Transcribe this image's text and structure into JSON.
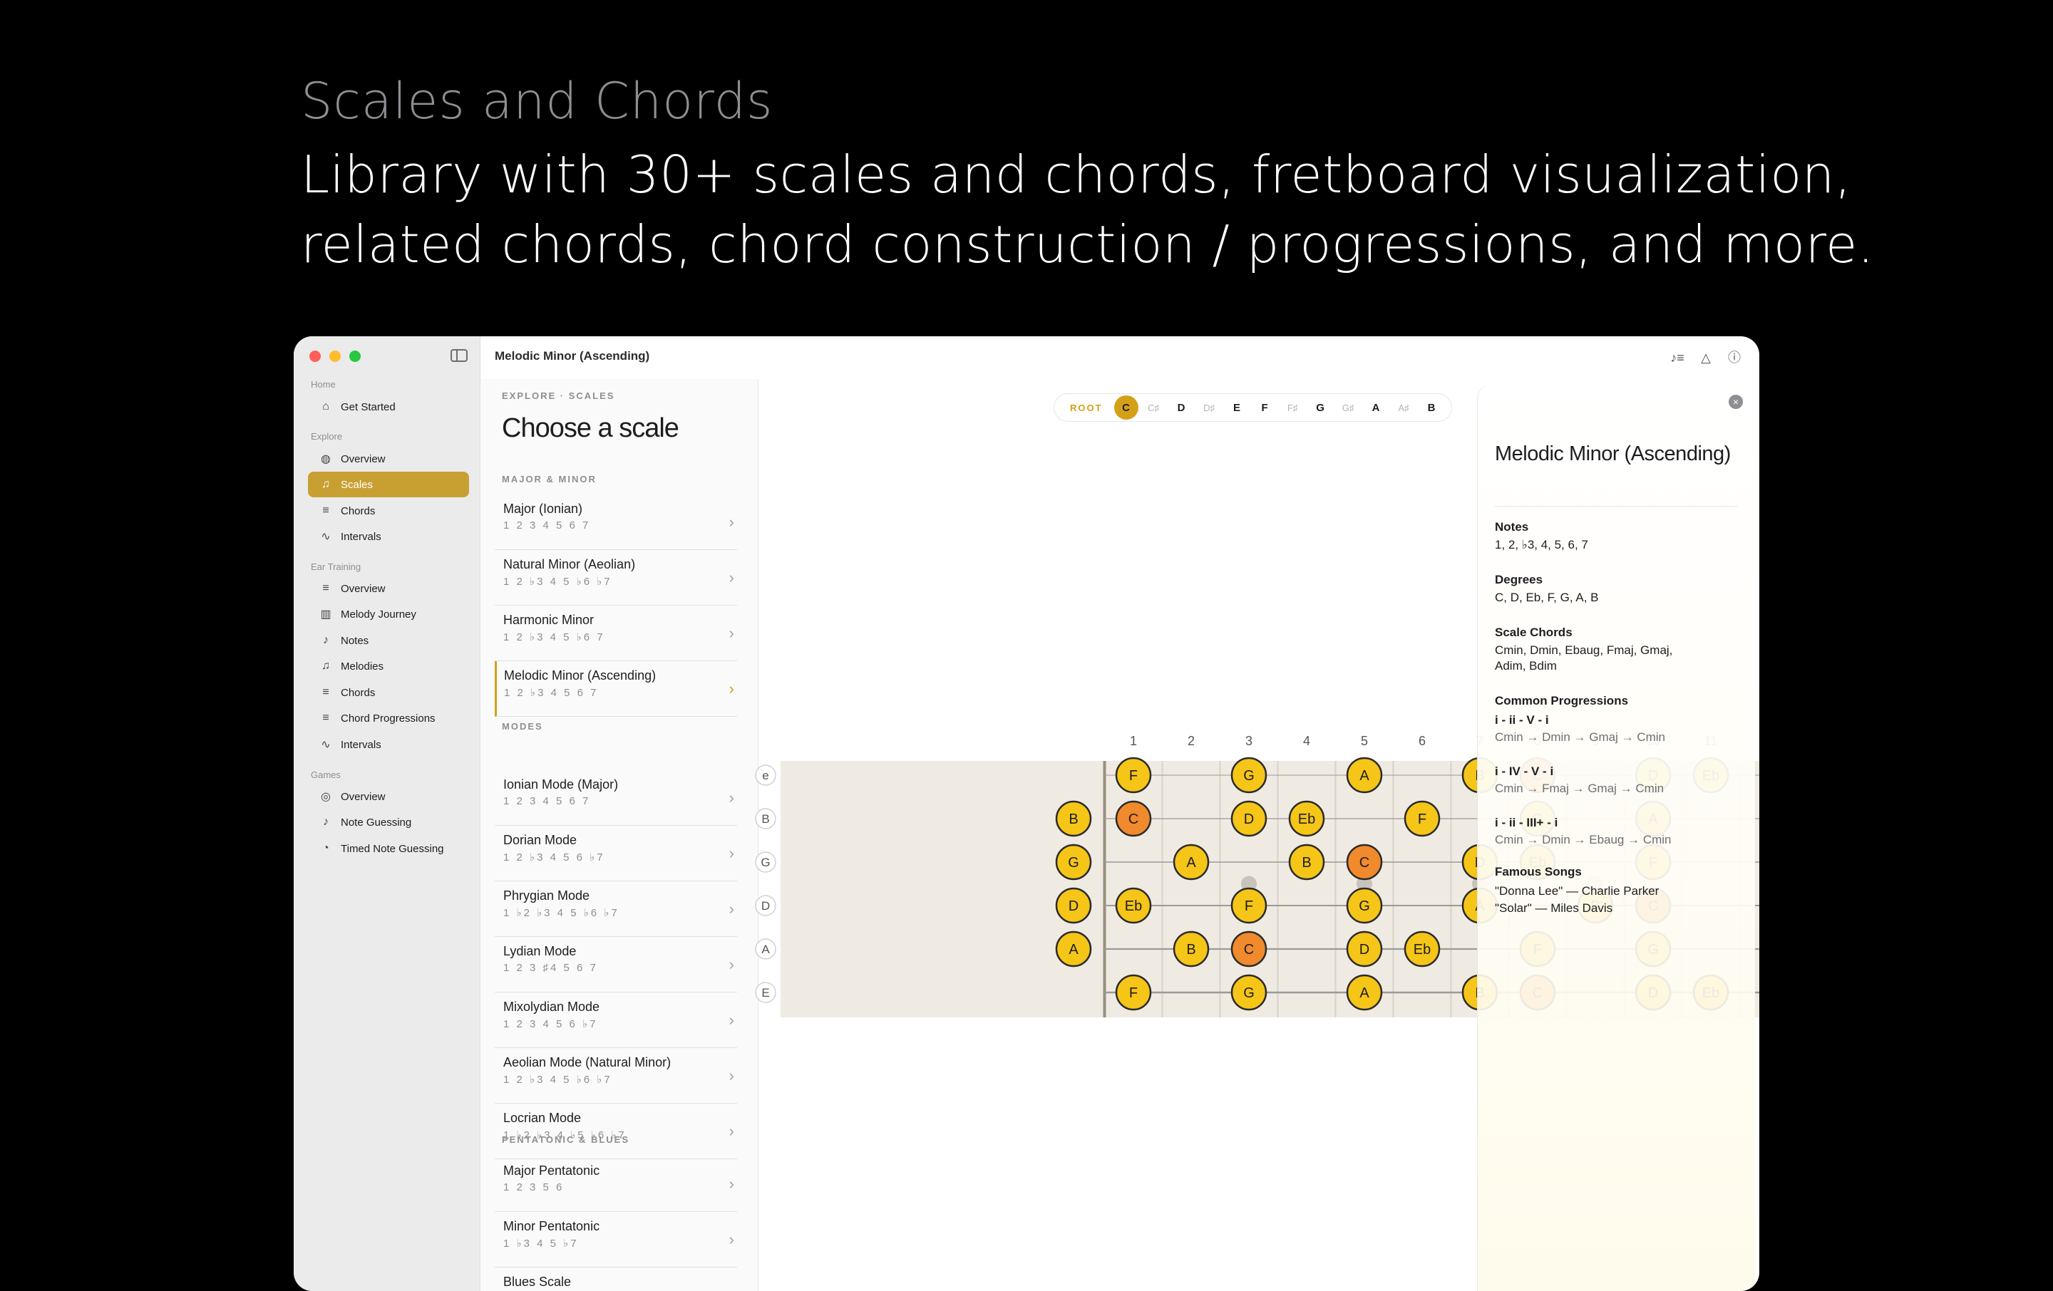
{
  "hero": {
    "kicker": "Scales and Chords",
    "line1": "Library with 30+ scales and chords, fretboard visualization,",
    "line2": "related chords, chord construction / progressions, and more."
  },
  "window": {
    "title": "Melodic Minor (Ascending)"
  },
  "sidebar": {
    "sections": [
      "Home",
      "Explore",
      "Ear Training",
      "Games"
    ],
    "items": [
      {
        "label": "Get Started",
        "icon": "house-icon"
      },
      {
        "label": "Overview",
        "icon": "globe-icon"
      },
      {
        "label": "Scales",
        "icon": "notes-icon"
      },
      {
        "label": "Chords",
        "icon": "chord-icon"
      },
      {
        "label": "Intervals",
        "icon": "waveform-icon"
      },
      {
        "label": "Overview",
        "icon": "chord-icon"
      },
      {
        "label": "Melody Journey",
        "icon": "map-icon"
      },
      {
        "label": "Notes",
        "icon": "note-icon"
      },
      {
        "label": "Melodies",
        "icon": "notes-icon"
      },
      {
        "label": "Chords",
        "icon": "chord-icon"
      },
      {
        "label": "Chord Progressions",
        "icon": "chord-icon"
      },
      {
        "label": "Intervals",
        "icon": "waveform-icon"
      },
      {
        "label": "Overview",
        "icon": "gamecontroller-icon"
      },
      {
        "label": "Note Guessing",
        "icon": "note-icon"
      },
      {
        "label": "Timed Note Guessing",
        "icon": "timer-icon"
      }
    ],
    "active_index": 2
  },
  "list": {
    "eyebrow": "EXPLORE · SCALES",
    "title": "Choose a scale",
    "groups": [
      "MAJOR & MINOR",
      "MODES",
      "PENTATONIC & BLUES"
    ],
    "rows": [
      {
        "name": "Major (Ionian)",
        "degrees": "1 2 3 4 5 6 7"
      },
      {
        "name": "Natural Minor (Aeolian)",
        "degrees": "1 2 ♭3 4 5 ♭6 ♭7"
      },
      {
        "name": "Harmonic Minor",
        "degrees": "1 2 ♭3 4 5 ♭6 7"
      },
      {
        "name": "Melodic Minor (Ascending)",
        "degrees": "1 2 ♭3 4 5 6 7"
      },
      {
        "name": "Ionian Mode (Major)",
        "degrees": "1 2 3 4 5 6 7"
      },
      {
        "name": "Dorian Mode",
        "degrees": "1 2 ♭3 4 5 6 ♭7"
      },
      {
        "name": "Phrygian Mode",
        "degrees": "1 ♭2 ♭3 4 5 ♭6 ♭7"
      },
      {
        "name": "Lydian Mode",
        "degrees": "1 2 3 ♯4 5 6 7"
      },
      {
        "name": "Mixolydian Mode",
        "degrees": "1 2 3 4 5 6 ♭7"
      },
      {
        "name": "Aeolian Mode (Natural Minor)",
        "degrees": "1 2 ♭3 4 5 ♭6 ♭7"
      },
      {
        "name": "Locrian Mode",
        "degrees": "1 ♭2 ♭3 4 ♭5 ♭6 ♭7"
      },
      {
        "name": "Major Pentatonic",
        "degrees": "1 2 3 5 6"
      },
      {
        "name": "Minor Pentatonic",
        "degrees": "1 ♭3 4 5 ♭7"
      },
      {
        "name": "Blues Scale",
        "degrees": ""
      }
    ],
    "selected_index": 3
  },
  "toolbar": {
    "icons": [
      "music-list-icon",
      "tuning-fork-icon",
      "info-icon"
    ]
  },
  "root": {
    "label": "ROOT",
    "keys": [
      "C",
      "C♯",
      "D",
      "D♯",
      "E",
      "F",
      "F♯",
      "G",
      "G♯",
      "A",
      "A♯",
      "B"
    ],
    "dim": [
      1,
      3,
      6,
      8,
      10
    ],
    "selected": 0
  },
  "fretboard": {
    "strings": [
      "e",
      "B",
      "G",
      "D",
      "A",
      "E"
    ],
    "fret_numbers": [
      "1",
      "2",
      "3",
      "4",
      "5",
      "6",
      "7",
      "8",
      "9",
      "10",
      "11"
    ],
    "inlay_frets": [
      3,
      5,
      7,
      9
    ],
    "colors": {
      "note": "#f5c518",
      "root": "#f08a2c",
      "wood": "#efebe3",
      "outline": "#2a2a2a"
    },
    "notes": [
      {
        "s": 0,
        "f": 1,
        "n": "F"
      },
      {
        "s": 0,
        "f": 3,
        "n": "G"
      },
      {
        "s": 0,
        "f": 5,
        "n": "A"
      },
      {
        "s": 0,
        "f": 7,
        "n": "B"
      },
      {
        "s": 0,
        "f": 8,
        "n": "C",
        "root": true
      },
      {
        "s": 0,
        "f": 10,
        "n": "D"
      },
      {
        "s": 0,
        "f": 11,
        "n": "Eb"
      },
      {
        "s": 1,
        "f": 0,
        "n": "B"
      },
      {
        "s": 1,
        "f": 1,
        "n": "C",
        "root": true
      },
      {
        "s": 1,
        "f": 3,
        "n": "D"
      },
      {
        "s": 1,
        "f": 4,
        "n": "Eb"
      },
      {
        "s": 1,
        "f": 6,
        "n": "F"
      },
      {
        "s": 1,
        "f": 8,
        "n": "G"
      },
      {
        "s": 1,
        "f": 10,
        "n": "A"
      },
      {
        "s": 2,
        "f": 0,
        "n": "G"
      },
      {
        "s": 2,
        "f": 2,
        "n": "A"
      },
      {
        "s": 2,
        "f": 4,
        "n": "B"
      },
      {
        "s": 2,
        "f": 5,
        "n": "C",
        "root": true
      },
      {
        "s": 2,
        "f": 7,
        "n": "D"
      },
      {
        "s": 2,
        "f": 8,
        "n": "Eb"
      },
      {
        "s": 2,
        "f": 10,
        "n": "F"
      },
      {
        "s": 3,
        "f": 0,
        "n": "D"
      },
      {
        "s": 3,
        "f": 1,
        "n": "Eb"
      },
      {
        "s": 3,
        "f": 3,
        "n": "F"
      },
      {
        "s": 3,
        "f": 5,
        "n": "G"
      },
      {
        "s": 3,
        "f": 7,
        "n": "A"
      },
      {
        "s": 3,
        "f": 9,
        "n": "B"
      },
      {
        "s": 3,
        "f": 10,
        "n": "C",
        "root": true
      },
      {
        "s": 4,
        "f": 0,
        "n": "A"
      },
      {
        "s": 4,
        "f": 2,
        "n": "B"
      },
      {
        "s": 4,
        "f": 3,
        "n": "C",
        "root": true
      },
      {
        "s": 4,
        "f": 5,
        "n": "D"
      },
      {
        "s": 4,
        "f": 6,
        "n": "Eb"
      },
      {
        "s": 4,
        "f": 8,
        "n": "F"
      },
      {
        "s": 4,
        "f": 10,
        "n": "G"
      },
      {
        "s": 5,
        "f": 1,
        "n": "F"
      },
      {
        "s": 5,
        "f": 3,
        "n": "G"
      },
      {
        "s": 5,
        "f": 5,
        "n": "A"
      },
      {
        "s": 5,
        "f": 7,
        "n": "B"
      },
      {
        "s": 5,
        "f": 8,
        "n": "C",
        "root": true
      },
      {
        "s": 5,
        "f": 10,
        "n": "D"
      },
      {
        "s": 5,
        "f": 11,
        "n": "Eb"
      }
    ]
  },
  "panel": {
    "title": "Melodic Minor (Ascending)",
    "notes_title": "Notes",
    "notes": "1, 2, ♭3, 4, 5, 6, 7",
    "degrees_title": "Degrees",
    "degrees": "C, D, Eb, F, G, A, B",
    "chords_title": "Scale Chords",
    "chords_line1": "Cmin, Dmin, Ebaug, Fmaj, Gmaj,",
    "chords_line2": "Adim, Bdim",
    "progressions_title": "Common Progressions",
    "progressions": [
      {
        "roman": "i - ii - V - i",
        "chords": "Cmin → Dmin → Gmaj → Cmin"
      },
      {
        "roman": "i - IV - V - i",
        "chords": "Cmin → Fmaj → Gmaj → Cmin"
      },
      {
        "roman": "i - ii - III+ - i",
        "chords": "Cmin → Dmin → Ebaug → Cmin"
      }
    ],
    "songs_title": "Famous Songs",
    "songs": [
      "\"Donna Lee\" — Charlie Parker",
      "\"Solar\" — Miles Davis"
    ]
  }
}
